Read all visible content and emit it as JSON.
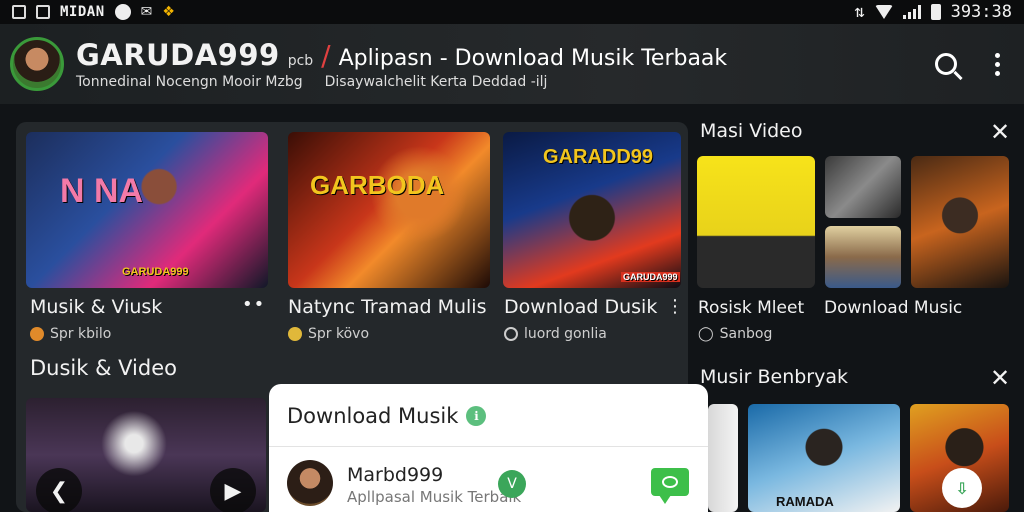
{
  "status_bar": {
    "app_name": "MIDAN",
    "time": "393:38",
    "icons": [
      "square-icon",
      "square-icon",
      "shield-icon",
      "notification-icon",
      "wifi-icon",
      "signal-icon",
      "battery-icon"
    ]
  },
  "app_bar": {
    "brand": "GARUDA999",
    "brand_suffix": "pcb",
    "headline": "Aplipasn - Download Musik Terbaak",
    "subtitle_left": "Tonnedinal Nocengn Mooir Mzbg",
    "subtitle_right": "Disaywalchelit Kerta Deddad -ilj",
    "icons": [
      "search-icon",
      "more-vert-icon"
    ]
  },
  "main": {
    "cards": [
      {
        "title": "Musik & Viusk",
        "meta": "Spr kbilo",
        "thumb_text": "N NA",
        "thumb_caption": "GARUDA999"
      },
      {
        "title": "Natync Tramad Mulis",
        "meta": "Spr kövo",
        "thumb_text": "GARBODA"
      },
      {
        "title": "Download Dusik",
        "meta": "luord gonlia",
        "thumb_text": "GARADD99",
        "thumb_caption": "GARUDA999"
      }
    ],
    "section_title": "Dusik & Video"
  },
  "popup": {
    "title": "Download Musik",
    "item_name": "Marbd999",
    "item_sub": "Apllpasal Musik Terbaik",
    "badge": "V"
  },
  "right": {
    "section1_title": "Masi Video",
    "section1_labels": [
      "Rosisk Mleet",
      "Download Music"
    ],
    "section1_meta": "Sanbog",
    "section2_title": "Musir Benbryak",
    "thumb_label": "RAMADA"
  },
  "colors": {
    "background": "#111417",
    "panel": "#24282b",
    "accent_green": "#3dbf4a",
    "accent_yellow": "#f2c51e"
  }
}
